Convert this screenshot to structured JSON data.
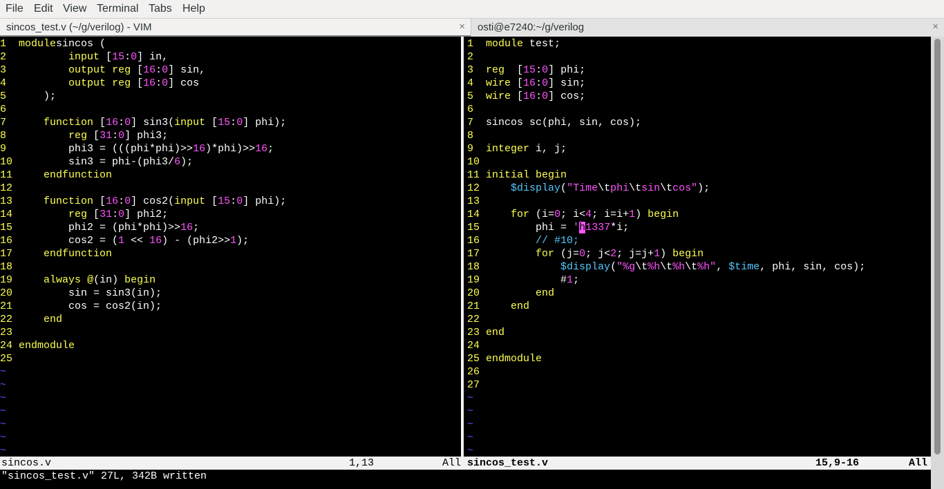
{
  "menubar": {
    "items": [
      {
        "label": "File"
      },
      {
        "label": "Edit"
      },
      {
        "label": "View"
      },
      {
        "label": "Terminal"
      },
      {
        "label": "Tabs"
      },
      {
        "label": "Help"
      }
    ]
  },
  "tabs": [
    {
      "title": "sincos_test.v (~/g/verilog) - VIM",
      "close": "×"
    },
    {
      "title": "osti@e7240:~/g/verilog",
      "close": "×"
    }
  ],
  "colors": {
    "line_number": "#ffff54",
    "keyword": "#ffff54",
    "number": "#ff55ff",
    "string": "#ff55ff",
    "system_task": "#55c8ff",
    "comment": "#55c8ff",
    "tilde": "#5656ff",
    "cursor": "#ff55ff"
  },
  "left_pane": {
    "tilde": "~",
    "tilde_count": 7,
    "lines": [
      {
        "n": "1",
        "parts": [
          [
            "kw",
            "module"
          ],
          [
            "",
            "sincos ("
          ]
        ]
      },
      {
        "n": "2",
        "parts": [
          [
            "",
            "        "
          ],
          [
            "kw",
            "input"
          ],
          [
            "",
            " ["
          ],
          [
            "num",
            "15"
          ],
          [
            "",
            ":"
          ],
          [
            "num",
            "0"
          ],
          [
            "",
            "] in,"
          ]
        ]
      },
      {
        "n": "3",
        "parts": [
          [
            "",
            "        "
          ],
          [
            "kw",
            "output"
          ],
          [
            "",
            " "
          ],
          [
            "kw",
            "reg"
          ],
          [
            "",
            " ["
          ],
          [
            "num",
            "16"
          ],
          [
            "",
            ":"
          ],
          [
            "num",
            "0"
          ],
          [
            "",
            "] sin,"
          ]
        ]
      },
      {
        "n": "4",
        "parts": [
          [
            "",
            "        "
          ],
          [
            "kw",
            "output"
          ],
          [
            "",
            " "
          ],
          [
            "kw",
            "reg"
          ],
          [
            "",
            " ["
          ],
          [
            "num",
            "16"
          ],
          [
            "",
            ":"
          ],
          [
            "num",
            "0"
          ],
          [
            "",
            "] cos"
          ]
        ]
      },
      {
        "n": "5",
        "parts": [
          [
            "",
            "    );"
          ]
        ]
      },
      {
        "n": "6",
        "parts": []
      },
      {
        "n": "7",
        "parts": [
          [
            "",
            "    "
          ],
          [
            "kw",
            "function"
          ],
          [
            "",
            " ["
          ],
          [
            "num",
            "16"
          ],
          [
            "",
            ":"
          ],
          [
            "num",
            "0"
          ],
          [
            "",
            "] sin3("
          ],
          [
            "kw",
            "input"
          ],
          [
            "",
            " ["
          ],
          [
            "num",
            "15"
          ],
          [
            "",
            ":"
          ],
          [
            "num",
            "0"
          ],
          [
            "",
            "] phi);"
          ]
        ]
      },
      {
        "n": "8",
        "parts": [
          [
            "",
            "        "
          ],
          [
            "kw",
            "reg"
          ],
          [
            "",
            " ["
          ],
          [
            "num",
            "31"
          ],
          [
            "",
            ":"
          ],
          [
            "num",
            "0"
          ],
          [
            "",
            "] phi3;"
          ]
        ]
      },
      {
        "n": "9",
        "parts": [
          [
            "",
            "        phi3 = (((phi*phi)>>"
          ],
          [
            "num",
            "16"
          ],
          [
            "",
            ")*phi)>>"
          ],
          [
            "num",
            "16"
          ],
          [
            "",
            ";"
          ]
        ]
      },
      {
        "n": "10",
        "parts": [
          [
            "",
            "        sin3 = phi-(phi3/"
          ],
          [
            "num",
            "6"
          ],
          [
            "",
            ");"
          ]
        ]
      },
      {
        "n": "11",
        "parts": [
          [
            "",
            "    "
          ],
          [
            "kw",
            "endfunction"
          ]
        ]
      },
      {
        "n": "12",
        "parts": []
      },
      {
        "n": "13",
        "parts": [
          [
            "",
            "    "
          ],
          [
            "kw",
            "function"
          ],
          [
            "",
            " ["
          ],
          [
            "num",
            "16"
          ],
          [
            "",
            ":"
          ],
          [
            "num",
            "0"
          ],
          [
            "",
            "] cos2("
          ],
          [
            "kw",
            "input"
          ],
          [
            "",
            " ["
          ],
          [
            "num",
            "15"
          ],
          [
            "",
            ":"
          ],
          [
            "num",
            "0"
          ],
          [
            "",
            "] phi);"
          ]
        ]
      },
      {
        "n": "14",
        "parts": [
          [
            "",
            "        "
          ],
          [
            "kw",
            "reg"
          ],
          [
            "",
            " ["
          ],
          [
            "num",
            "31"
          ],
          [
            "",
            ":"
          ],
          [
            "num",
            "0"
          ],
          [
            "",
            "] phi2;"
          ]
        ]
      },
      {
        "n": "15",
        "parts": [
          [
            "",
            "        phi2 = (phi*phi)>>"
          ],
          [
            "num",
            "16"
          ],
          [
            "",
            ";"
          ]
        ]
      },
      {
        "n": "16",
        "parts": [
          [
            "",
            "        cos2 = ("
          ],
          [
            "num",
            "1"
          ],
          [
            "",
            " << "
          ],
          [
            "num",
            "16"
          ],
          [
            "",
            ") - (phi2>>"
          ],
          [
            "num",
            "1"
          ],
          [
            "",
            ");"
          ]
        ]
      },
      {
        "n": "17",
        "parts": [
          [
            "",
            "    "
          ],
          [
            "kw",
            "endfunction"
          ]
        ]
      },
      {
        "n": "18",
        "parts": []
      },
      {
        "n": "19",
        "parts": [
          [
            "",
            "    "
          ],
          [
            "kw",
            "always"
          ],
          [
            "",
            " "
          ],
          [
            "kw",
            "@"
          ],
          [
            "",
            "(in) "
          ],
          [
            "kw",
            "begin"
          ]
        ]
      },
      {
        "n": "20",
        "parts": [
          [
            "",
            "        sin = sin3(in);"
          ]
        ]
      },
      {
        "n": "21",
        "parts": [
          [
            "",
            "        cos = cos2(in);"
          ]
        ]
      },
      {
        "n": "22",
        "parts": [
          [
            "",
            "    "
          ],
          [
            "kw",
            "end"
          ]
        ]
      },
      {
        "n": "23",
        "parts": []
      },
      {
        "n": "24",
        "parts": [
          [
            "kw",
            "endmodule"
          ]
        ]
      },
      {
        "n": "25",
        "parts": []
      }
    ]
  },
  "right_pane": {
    "tilde": "~",
    "tilde_count": 5,
    "lines": [
      {
        "n": "1",
        "parts": [
          [
            "kw",
            "module"
          ],
          [
            "",
            " test;"
          ]
        ]
      },
      {
        "n": "2",
        "parts": []
      },
      {
        "n": "3",
        "parts": [
          [
            "kw",
            "reg"
          ],
          [
            "",
            "  ["
          ],
          [
            "num",
            "15"
          ],
          [
            "",
            ":"
          ],
          [
            "num",
            "0"
          ],
          [
            "",
            "] phi;"
          ]
        ]
      },
      {
        "n": "4",
        "parts": [
          [
            "kw",
            "wire"
          ],
          [
            "",
            " ["
          ],
          [
            "num",
            "16"
          ],
          [
            "",
            ":"
          ],
          [
            "num",
            "0"
          ],
          [
            "",
            "] sin;"
          ]
        ]
      },
      {
        "n": "5",
        "parts": [
          [
            "kw",
            "wire"
          ],
          [
            "",
            " ["
          ],
          [
            "num",
            "16"
          ],
          [
            "",
            ":"
          ],
          [
            "num",
            "0"
          ],
          [
            "",
            "] cos;"
          ]
        ]
      },
      {
        "n": "6",
        "parts": []
      },
      {
        "n": "7",
        "parts": [
          [
            "",
            "sincos sc(phi, sin, cos);"
          ]
        ]
      },
      {
        "n": "8",
        "parts": []
      },
      {
        "n": "9",
        "parts": [
          [
            "kw",
            "integer"
          ],
          [
            "",
            " i, j;"
          ]
        ]
      },
      {
        "n": "10",
        "parts": []
      },
      {
        "n": "11",
        "parts": [
          [
            "kw",
            "initial"
          ],
          [
            "",
            " "
          ],
          [
            "kw",
            "begin"
          ]
        ]
      },
      {
        "n": "12",
        "parts": [
          [
            "",
            "    "
          ],
          [
            "sys",
            "$display"
          ],
          [
            "",
            "("
          ],
          [
            "str",
            "\"Time"
          ],
          [
            "",
            "\\t"
          ],
          [
            "str",
            "phi"
          ],
          [
            "",
            "\\t"
          ],
          [
            "str",
            "sin"
          ],
          [
            "",
            "\\t"
          ],
          [
            "str",
            "cos\""
          ],
          [
            "",
            ");"
          ]
        ]
      },
      {
        "n": "13",
        "parts": []
      },
      {
        "n": "14",
        "parts": [
          [
            "",
            "    "
          ],
          [
            "kw",
            "for"
          ],
          [
            "",
            " (i="
          ],
          [
            "num",
            "0"
          ],
          [
            "",
            "; i<"
          ],
          [
            "num",
            "4"
          ],
          [
            "",
            "; i=i+"
          ],
          [
            "num",
            "1"
          ],
          [
            "",
            ") "
          ],
          [
            "kw",
            "begin"
          ]
        ]
      },
      {
        "n": "15",
        "parts": [
          [
            "",
            "        phi = "
          ],
          [
            "num",
            "'"
          ],
          [
            "cursor",
            "h"
          ],
          [
            "num",
            "1337"
          ],
          [
            "",
            "*i;"
          ]
        ]
      },
      {
        "n": "16",
        "parts": [
          [
            "",
            "        "
          ],
          [
            "cmt",
            "// #10;"
          ]
        ]
      },
      {
        "n": "17",
        "parts": [
          [
            "",
            "        "
          ],
          [
            "kw",
            "for"
          ],
          [
            "",
            " (j="
          ],
          [
            "num",
            "0"
          ],
          [
            "",
            "; j<"
          ],
          [
            "num",
            "2"
          ],
          [
            "",
            "; j=j+"
          ],
          [
            "num",
            "1"
          ],
          [
            "",
            ") "
          ],
          [
            "kw",
            "begin"
          ]
        ]
      },
      {
        "n": "18",
        "parts": [
          [
            "",
            "            "
          ],
          [
            "sys",
            "$display"
          ],
          [
            "",
            "("
          ],
          [
            "str",
            "\"%g"
          ],
          [
            "",
            "\\t"
          ],
          [
            "str",
            "%h"
          ],
          [
            "",
            "\\t"
          ],
          [
            "str",
            "%h"
          ],
          [
            "",
            "\\t"
          ],
          [
            "str",
            "%h\""
          ],
          [
            "",
            ", "
          ],
          [
            "sys",
            "$time"
          ],
          [
            "",
            ", phi, sin, cos);"
          ]
        ]
      },
      {
        "n": "19",
        "parts": [
          [
            "",
            "            #"
          ],
          [
            "num",
            "1"
          ],
          [
            "",
            ";"
          ]
        ]
      },
      {
        "n": "20",
        "parts": [
          [
            "",
            "        "
          ],
          [
            "kw",
            "end"
          ]
        ]
      },
      {
        "n": "21",
        "parts": [
          [
            "",
            "    "
          ],
          [
            "kw",
            "end"
          ]
        ]
      },
      {
        "n": "22",
        "parts": []
      },
      {
        "n": "23",
        "parts": [
          [
            "kw",
            "end"
          ]
        ]
      },
      {
        "n": "24",
        "parts": []
      },
      {
        "n": "25",
        "parts": [
          [
            "kw",
            "endmodule"
          ]
        ]
      },
      {
        "n": "26",
        "parts": []
      },
      {
        "n": "27",
        "parts": []
      }
    ]
  },
  "status_left": {
    "file": "sincos.v",
    "pos": "1,13",
    "scroll": "All"
  },
  "status_right": {
    "file": "sincos_test.v",
    "pos": "15,9-16",
    "scroll": "All"
  },
  "cmdline": "\"sincos_test.v\" 27L, 342B written"
}
